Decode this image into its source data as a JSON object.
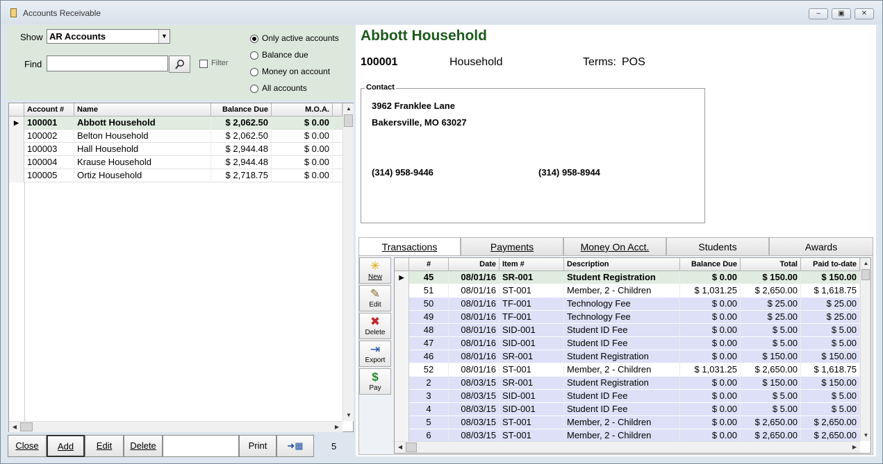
{
  "window": {
    "title": "Accounts Receivable"
  },
  "filters": {
    "show_label": "Show",
    "show_value": "AR Accounts",
    "find_label": "Find",
    "find_value": "",
    "filter_label": "Filter",
    "radios": [
      {
        "label": "Only active accounts",
        "selected": true
      },
      {
        "label": "Balance due",
        "selected": false
      },
      {
        "label": "Money on account",
        "selected": false
      },
      {
        "label": "All accounts",
        "selected": false
      }
    ]
  },
  "accounts": {
    "columns": [
      "Account #",
      "Name",
      "Balance Due",
      "M.O.A."
    ],
    "rows": [
      {
        "num": "100001",
        "name": "Abbott Household",
        "balance": "$ 2,062.50",
        "moa": "$ 0.00"
      },
      {
        "num": "100002",
        "name": "Belton Household",
        "balance": "$ 2,062.50",
        "moa": "$ 0.00"
      },
      {
        "num": "100003",
        "name": "Hall Household",
        "balance": "$ 2,944.48",
        "moa": "$ 0.00"
      },
      {
        "num": "100004",
        "name": "Krause Household",
        "balance": "$ 2,944.48",
        "moa": "$ 0.00"
      },
      {
        "num": "100005",
        "name": "Ortiz Household",
        "balance": "$ 2,718.75",
        "moa": "$ 0.00"
      }
    ]
  },
  "bottom": {
    "close": "Close",
    "add": "Add",
    "edit": "Edit",
    "delete": "Delete",
    "print": "Print",
    "count": "5"
  },
  "detail": {
    "name": "Abbott Household",
    "number": "100001",
    "type": "Household",
    "terms_label": "Terms:",
    "terms_value": "POS",
    "contact_label": "Contact",
    "address1": "3962 Franklee Lane",
    "address2": "Bakersville, MO  63027",
    "phone1": "(314) 958-9446",
    "phone2": "(314) 958-8944"
  },
  "tabs": [
    "Transactions",
    "Payments",
    "Money On Acct.",
    "Students",
    "Awards"
  ],
  "toolbar": {
    "new": "New",
    "edit": "Edit",
    "delete": "Delete",
    "export": "Export",
    "pay": "Pay"
  },
  "transactions": {
    "columns": [
      "#",
      "Date",
      "Item #",
      "Description",
      "Balance Due",
      "Total",
      "Paid to-date"
    ],
    "rows": [
      {
        "n": "45",
        "date": "08/01/16",
        "item": "SR-001",
        "desc": "Student Registration",
        "bal": "$ 0.00",
        "total": "$ 150.00",
        "paid": "$ 150.00"
      },
      {
        "n": "51",
        "date": "08/01/16",
        "item": "ST-001",
        "desc": "Member, 2 - Children",
        "bal": "$ 1,031.25",
        "total": "$ 2,650.00",
        "paid": "$ 1,618.75"
      },
      {
        "n": "50",
        "date": "08/01/16",
        "item": "TF-001",
        "desc": "Technology Fee",
        "bal": "$ 0.00",
        "total": "$ 25.00",
        "paid": "$ 25.00"
      },
      {
        "n": "49",
        "date": "08/01/16",
        "item": "TF-001",
        "desc": "Technology Fee",
        "bal": "$ 0.00",
        "total": "$ 25.00",
        "paid": "$ 25.00"
      },
      {
        "n": "48",
        "date": "08/01/16",
        "item": "SID-001",
        "desc": "Student ID Fee",
        "bal": "$ 0.00",
        "total": "$ 5.00",
        "paid": "$ 5.00"
      },
      {
        "n": "47",
        "date": "08/01/16",
        "item": "SID-001",
        "desc": "Student ID Fee",
        "bal": "$ 0.00",
        "total": "$ 5.00",
        "paid": "$ 5.00"
      },
      {
        "n": "46",
        "date": "08/01/16",
        "item": "SR-001",
        "desc": "Student Registration",
        "bal": "$ 0.00",
        "total": "$ 150.00",
        "paid": "$ 150.00"
      },
      {
        "n": "52",
        "date": "08/01/16",
        "item": "ST-001",
        "desc": "Member, 2 - Children",
        "bal": "$ 1,031.25",
        "total": "$ 2,650.00",
        "paid": "$ 1,618.75"
      },
      {
        "n": "2",
        "date": "08/03/15",
        "item": "SR-001",
        "desc": "Student Registration",
        "bal": "$ 0.00",
        "total": "$ 150.00",
        "paid": "$ 150.00"
      },
      {
        "n": "3",
        "date": "08/03/15",
        "item": "SID-001",
        "desc": "Student ID Fee",
        "bal": "$ 0.00",
        "total": "$ 5.00",
        "paid": "$ 5.00"
      },
      {
        "n": "4",
        "date": "08/03/15",
        "item": "SID-001",
        "desc": "Student ID Fee",
        "bal": "$ 0.00",
        "total": "$ 5.00",
        "paid": "$ 5.00"
      },
      {
        "n": "5",
        "date": "08/03/15",
        "item": "ST-001",
        "desc": "Member, 2 - Children",
        "bal": "$ 0.00",
        "total": "$ 2,650.00",
        "paid": "$ 2,650.00"
      },
      {
        "n": "6",
        "date": "08/03/15",
        "item": "ST-001",
        "desc": "Member, 2 - Children",
        "bal": "$ 0.00",
        "total": "$ 2,650.00",
        "paid": "$ 2,650.00"
      }
    ]
  }
}
